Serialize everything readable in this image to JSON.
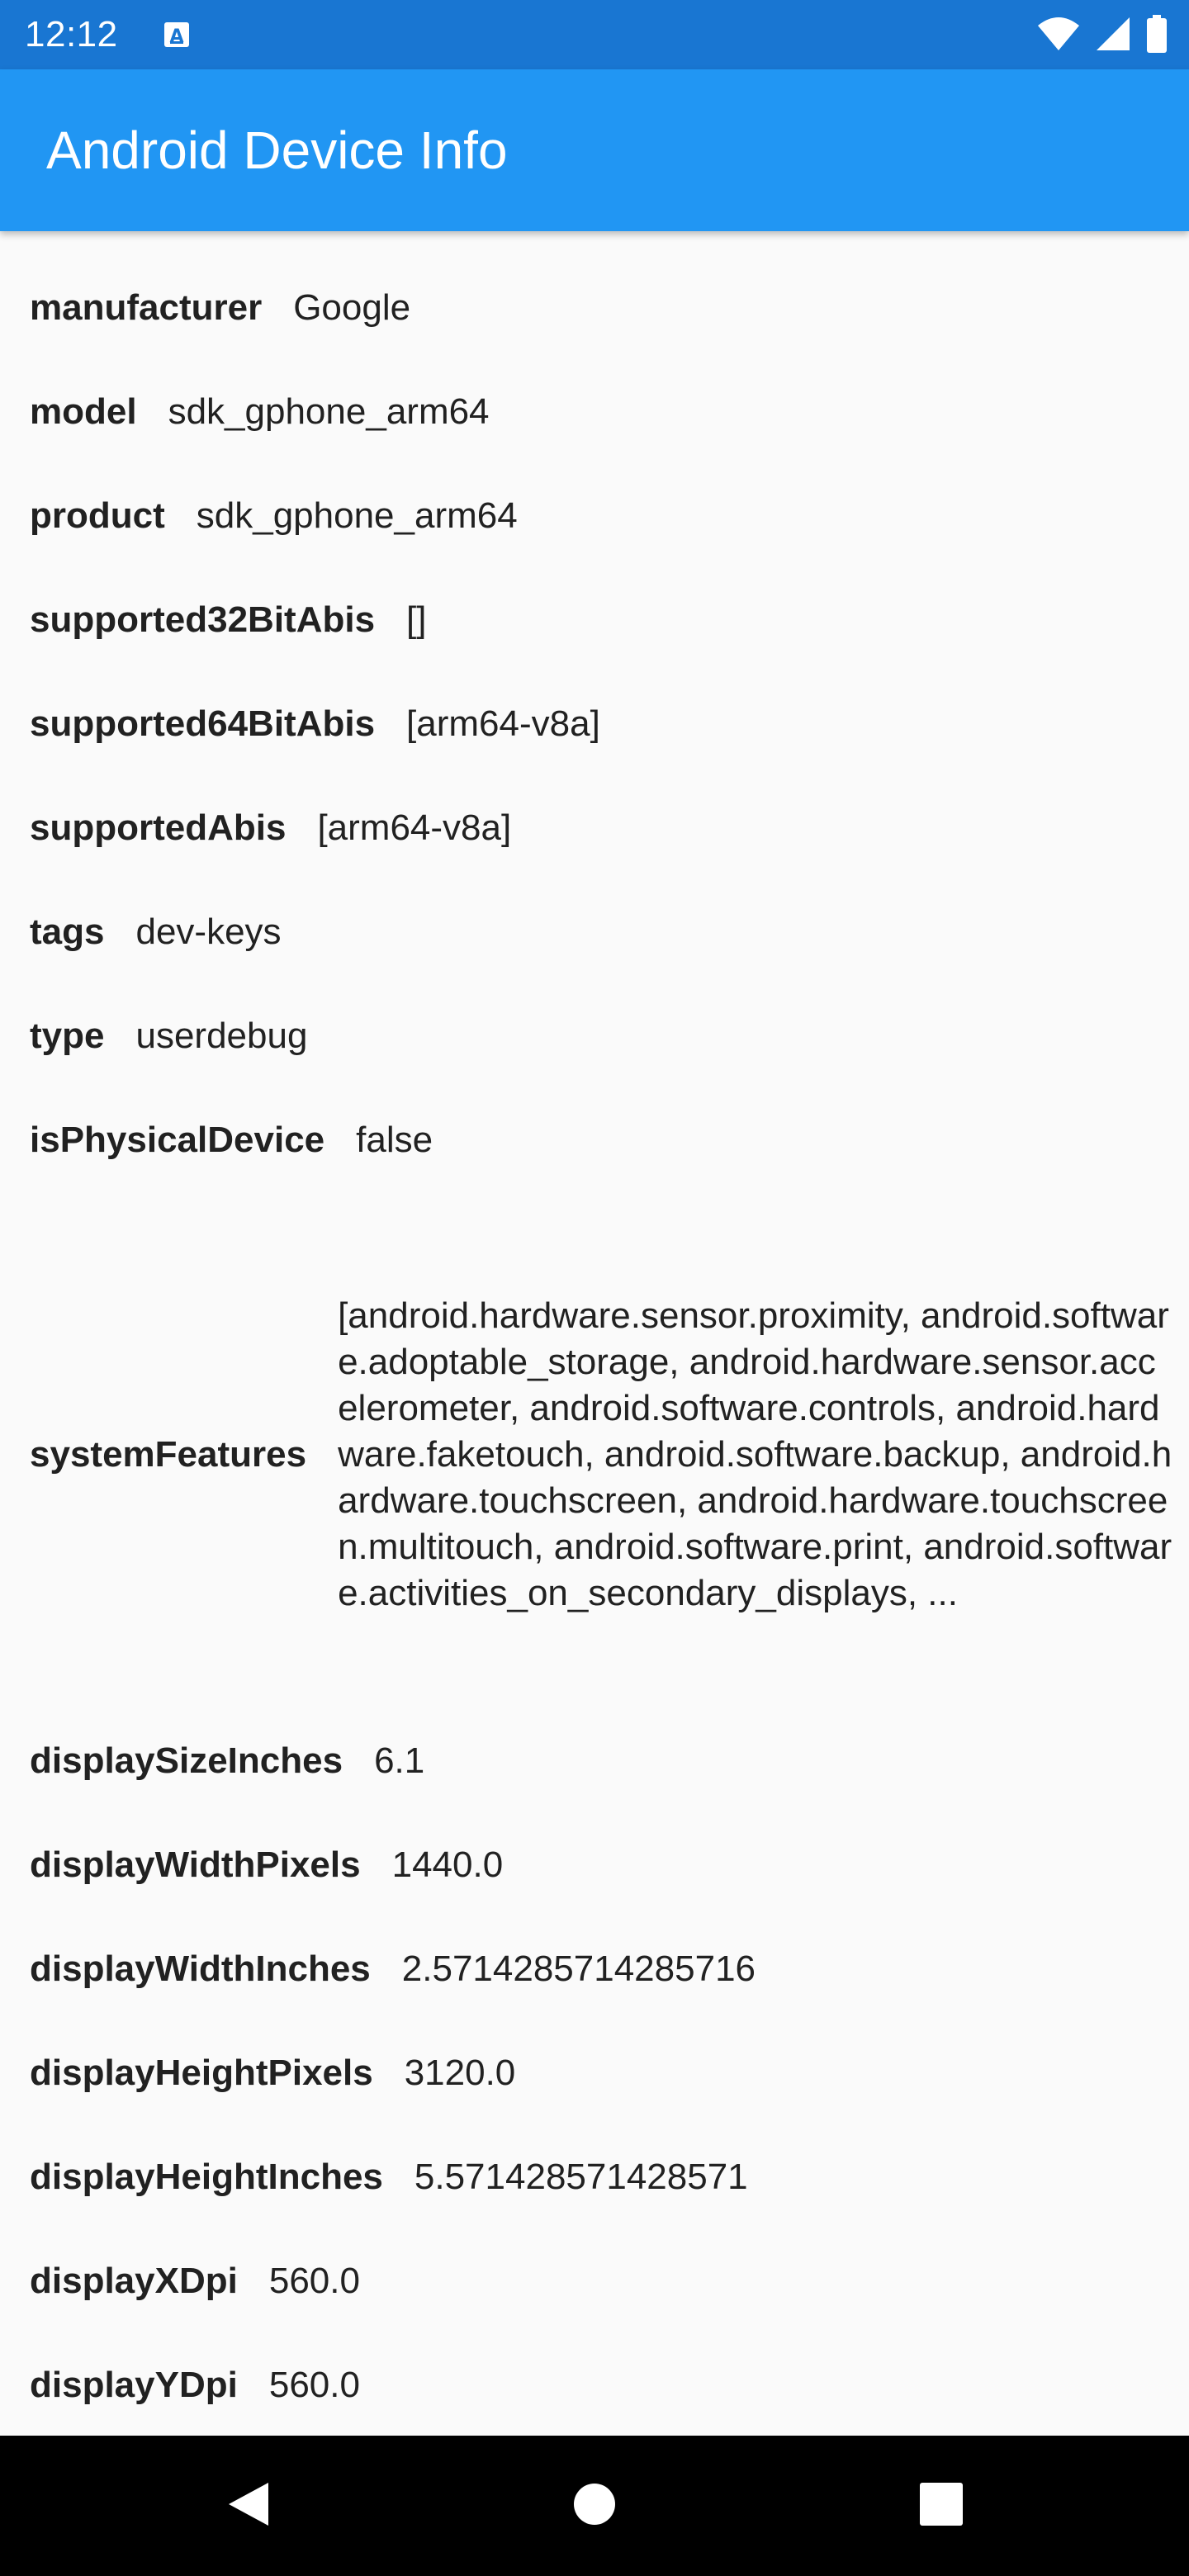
{
  "status_bar": {
    "time": "12:12",
    "icons": [
      "app-notification-icon",
      "wifi-icon",
      "cellular-signal-icon",
      "battery-icon"
    ]
  },
  "app_bar": {
    "title": "Android Device Info",
    "color": "#2196f3"
  },
  "device_info": [
    {
      "key": "manufacturer",
      "value": "Google"
    },
    {
      "key": "model",
      "value": "sdk_gphone_arm64"
    },
    {
      "key": "product",
      "value": "sdk_gphone_arm64"
    },
    {
      "key": "supported32BitAbis",
      "value": "[]"
    },
    {
      "key": "supported64BitAbis",
      "value": "[arm64-v8a]"
    },
    {
      "key": "supportedAbis",
      "value": "[arm64-v8a]"
    },
    {
      "key": "tags",
      "value": "dev-keys"
    },
    {
      "key": "type",
      "value": "userdebug"
    },
    {
      "key": "isPhysicalDevice",
      "value": "false"
    },
    {
      "key": "systemFeatures",
      "value": "[android.hardware.sensor.proximity, android.software.adoptable_storage, android.hardware.sensor.accelerometer, android.software.controls, android.hardware.faketouch, android.software.backup, android.hardware.touchscreen, android.hardware.touchscreen.multitouch, android.software.print, android.software.activities_on_secondary_displays, ..."
    },
    {
      "key": "displaySizeInches",
      "value": "6.1"
    },
    {
      "key": "displayWidthPixels",
      "value": "1440.0"
    },
    {
      "key": "displayWidthInches",
      "value": "2.5714285714285716"
    },
    {
      "key": "displayHeightPixels",
      "value": "3120.0"
    },
    {
      "key": "displayHeightInches",
      "value": "5.571428571428571"
    },
    {
      "key": "displayXDpi",
      "value": "560.0"
    },
    {
      "key": "displayYDpi",
      "value": "560.0"
    }
  ],
  "nav_bar": {
    "icons": [
      "back-icon",
      "home-icon",
      "recents-icon"
    ]
  }
}
